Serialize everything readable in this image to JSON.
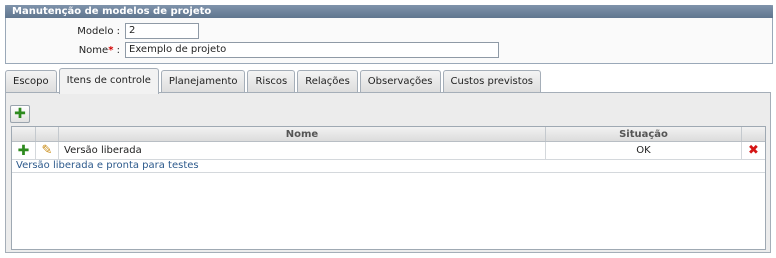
{
  "panel": {
    "title": "Manutenção de modelos de projeto",
    "fields": {
      "modelo": {
        "label": "Modelo :",
        "value": "2"
      },
      "nome": {
        "label": "Nome",
        "required_mark": "*",
        "colon": ":",
        "value": "Exemplo de projeto"
      }
    }
  },
  "tabs": [
    {
      "label": "Escopo",
      "active": false
    },
    {
      "label": "Itens de controle",
      "active": true
    },
    {
      "label": "Planejamento",
      "active": false
    },
    {
      "label": "Riscos",
      "active": false
    },
    {
      "label": "Relações",
      "active": false
    },
    {
      "label": "Observações",
      "active": false
    },
    {
      "label": "Custos previstos",
      "active": false
    }
  ],
  "grid": {
    "columns": {
      "nome": "Nome",
      "situacao": "Situação"
    },
    "rows": [
      {
        "nome": "Versão liberada",
        "situacao": "OK",
        "detail": "Versão liberada e pronta para testes"
      }
    ]
  },
  "icons": {
    "add": "plus-icon",
    "edit": "pencil-icon",
    "delete": "delete-x-icon"
  },
  "colors": {
    "header_bar": "#6d829b",
    "required": "#d20000",
    "add_green": "#2d8a1e",
    "delete_red": "#d51616",
    "detail_link": "#2d5a8c"
  }
}
